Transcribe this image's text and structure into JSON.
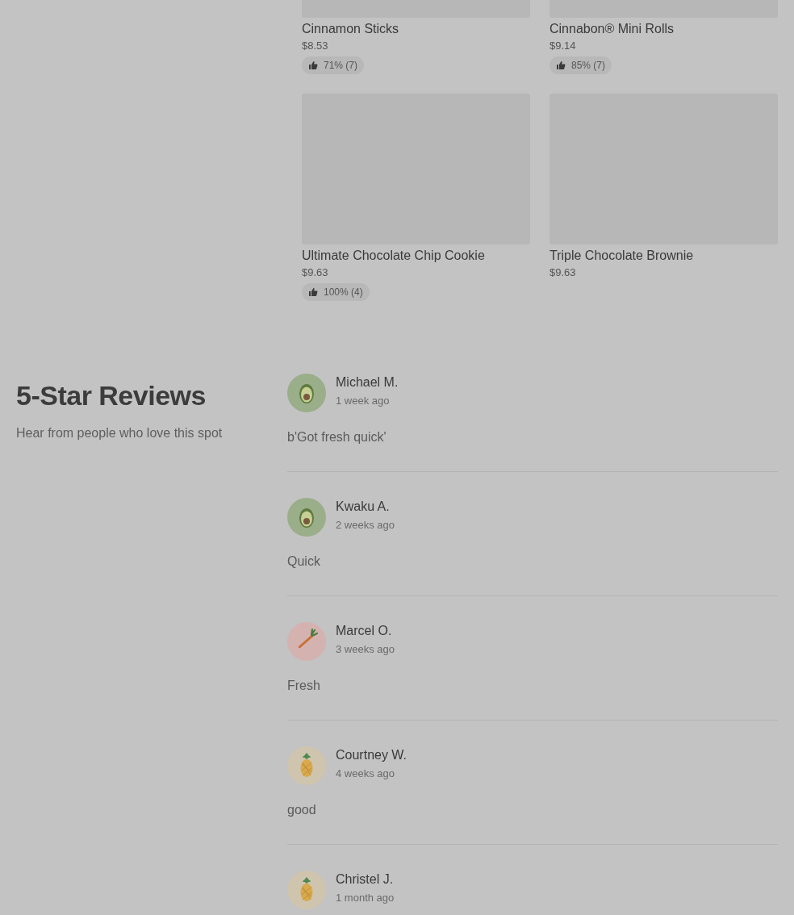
{
  "products": [
    {
      "name": "Cinnamon Sticks",
      "price": "$8.53",
      "rating": "71% (7)"
    },
    {
      "name": "Cinnabon® Mini Rolls",
      "price": "$9.14",
      "rating": "85% (7)"
    },
    {
      "name": "Ultimate Chocolate Chip Cookie",
      "price": "$9.63",
      "rating": "100% (4)"
    },
    {
      "name": "Triple Chocolate Brownie",
      "price": "$9.63"
    }
  ],
  "reviews_section": {
    "title": "5-Star Reviews",
    "subtitle": "Hear from people who love this spot"
  },
  "reviews": [
    {
      "name": "Michael M.",
      "time": "1 week ago",
      "text": "b'Got fresh quick'",
      "kind": "avocado"
    },
    {
      "name": "Kwaku A.",
      "time": "2 weeks ago",
      "text": "Quick",
      "kind": "avocado"
    },
    {
      "name": "Marcel O.",
      "time": "3 weeks ago",
      "text": "Fresh",
      "kind": "carrot"
    },
    {
      "name": "Courtney W.",
      "time": "4 weeks ago",
      "text": "good",
      "kind": "pineapple"
    },
    {
      "name": "Christel J.",
      "time": "1 month ago",
      "kind": "pineapple"
    }
  ]
}
